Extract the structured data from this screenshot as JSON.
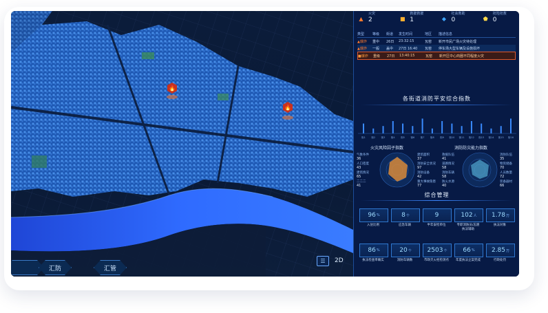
{
  "stats": [
    {
      "icon": "fire-icon",
      "label": "火灾",
      "value": "2",
      "color": "#ff7a2e"
    },
    {
      "icon": "truck-icon",
      "label": "救援救援",
      "value": "1",
      "color": "#ffb030"
    },
    {
      "icon": "alarm-icon",
      "label": "社会救助",
      "value": "0",
      "color": "#3ea6ff"
    },
    {
      "icon": "shield-icon",
      "label": "抢险抢救",
      "value": "0",
      "color": "#ffd84a"
    }
  ],
  "table": {
    "headers": [
      "类型",
      "等级",
      "街道",
      "发生时间",
      "地区",
      "描述信息"
    ],
    "rows": [
      {
        "type": "爆炸",
        "level": "重中",
        "street": "26日",
        "time": "23:32:15",
        "area": "瓦窑",
        "desc": "新开市民广场火灾待处理"
      },
      {
        "type": "爆炸",
        "level": "一般",
        "street": "盖中",
        "time": "27日 16:40",
        "area": "瓦窑",
        "desc": "停车场大型车辆及设施损坏"
      },
      {
        "type": "爆炸",
        "level": "重级",
        "street": "27日",
        "time": "13:40:15",
        "area": "瓦窑",
        "desc": "新开区中心商圈不同程度火灾"
      }
    ]
  },
  "bar_section_title": "各街道消防平安综合指数",
  "chart_data": {
    "type": "bar",
    "title": "各街道消防平安综合指数",
    "categories": [
      "街1",
      "街2",
      "街3",
      "街4",
      "街5",
      "街6",
      "街7",
      "街8",
      "街9",
      "街10",
      "街11",
      "街12",
      "街13",
      "街14",
      "街15",
      "街16"
    ],
    "values": [
      4,
      2,
      3,
      5,
      4,
      3,
      6,
      2,
      5,
      4,
      3,
      5,
      4,
      2,
      3,
      6
    ],
    "ylim": [
      0,
      10
    ]
  },
  "risk": {
    "left_title": "火灾风险因子指数",
    "right_title": "消防防灾能力指数",
    "left_labels": [
      {
        "label": "气象条件",
        "value": "36"
      },
      {
        "label": "人口密度",
        "value": "43"
      },
      {
        "label": "建筑情况",
        "value": "65"
      },
      {
        "label": "二二二",
        "value": "41"
      }
    ],
    "mid_left_labels": [
      {
        "label": "建筑面积",
        "value": "37"
      },
      {
        "label": "消防安全状况",
        "value": "97"
      },
      {
        "label": "消防设备",
        "value": "42"
      },
      {
        "label": "重大事故隐患",
        "value": "77"
      }
    ],
    "mid_right_labels": [
      {
        "label": "救援队伍",
        "value": "41"
      },
      {
        "label": "道路情况",
        "value": "58"
      },
      {
        "label": "消防车辆",
        "value": "58"
      },
      {
        "label": "防火水源",
        "value": "40"
      }
    ],
    "right_labels": [
      {
        "label": "消防队伍",
        "value": "35"
      },
      {
        "label": "物资储备",
        "value": "70"
      },
      {
        "label": "人员数量",
        "value": "72"
      },
      {
        "label": "装备器材",
        "value": "66"
      }
    ]
  },
  "management": {
    "title": "综合管理",
    "row1": [
      {
        "value": "96",
        "unit": "%",
        "label": "入驻比例"
      },
      {
        "value": "8",
        "unit": "个",
        "label": "应急车辆"
      },
      {
        "value": "9",
        "unit": "",
        "label": "半年安检单位"
      },
      {
        "value": "102",
        "unit": "人",
        "label": "专职消防员/志愿\n执法辅助"
      },
      {
        "value": "1.78",
        "unit": "万",
        "label": "执法对象"
      }
    ],
    "row2": [
      {
        "value": "86",
        "unit": "%",
        "label": "执法检查率确实"
      },
      {
        "value": "20",
        "unit": "个",
        "label": "消防车辆数"
      },
      {
        "value": "2503",
        "unit": "个",
        "label": "市政灭火栓检测点"
      },
      {
        "value": "66",
        "unit": "%",
        "label": "年度执法立案完成"
      },
      {
        "value": "2.85",
        "unit": "万",
        "label": "行政处罚"
      }
    ]
  },
  "map": {
    "buttons": [
      "汇防",
      "汇管"
    ],
    "view_mode": "2D",
    "colors": {
      "city": "#2f78e6",
      "river": "#1f62ff",
      "fire": "#c8311f"
    }
  }
}
